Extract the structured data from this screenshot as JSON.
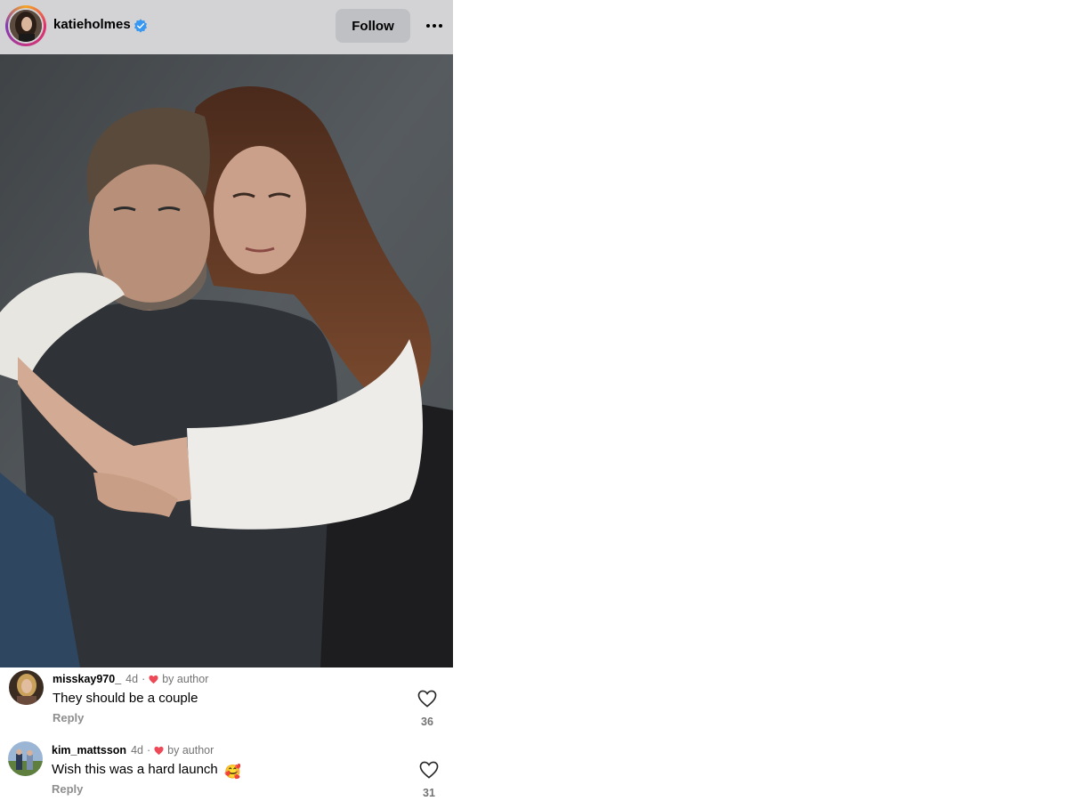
{
  "post": {
    "username": "katieholmes",
    "follow_label": "Follow",
    "verified_icon": "verified-badge-icon",
    "more_icon": "more-options-icon",
    "image_description_icon": "post-photo"
  },
  "comments": [
    {
      "username": "misskay970_",
      "time": "4d",
      "separator": "·",
      "liked_by": "by author",
      "text": "They should be a couple",
      "emoji": "",
      "reply_label": "Reply",
      "like_count": "36"
    },
    {
      "username": "kim_mattsson",
      "time": "4d",
      "separator": "·",
      "liked_by": "by author",
      "text": "Wish this was a hard launch",
      "emoji": "🥰",
      "reply_label": "Reply",
      "like_count": "31"
    }
  ],
  "colors": {
    "header_bg": "#d3d3d5",
    "follow_bg": "#bfc0c4",
    "verified_blue": "#3897f0",
    "liked_heart": "#ed4956",
    "muted_text": "#737373"
  }
}
